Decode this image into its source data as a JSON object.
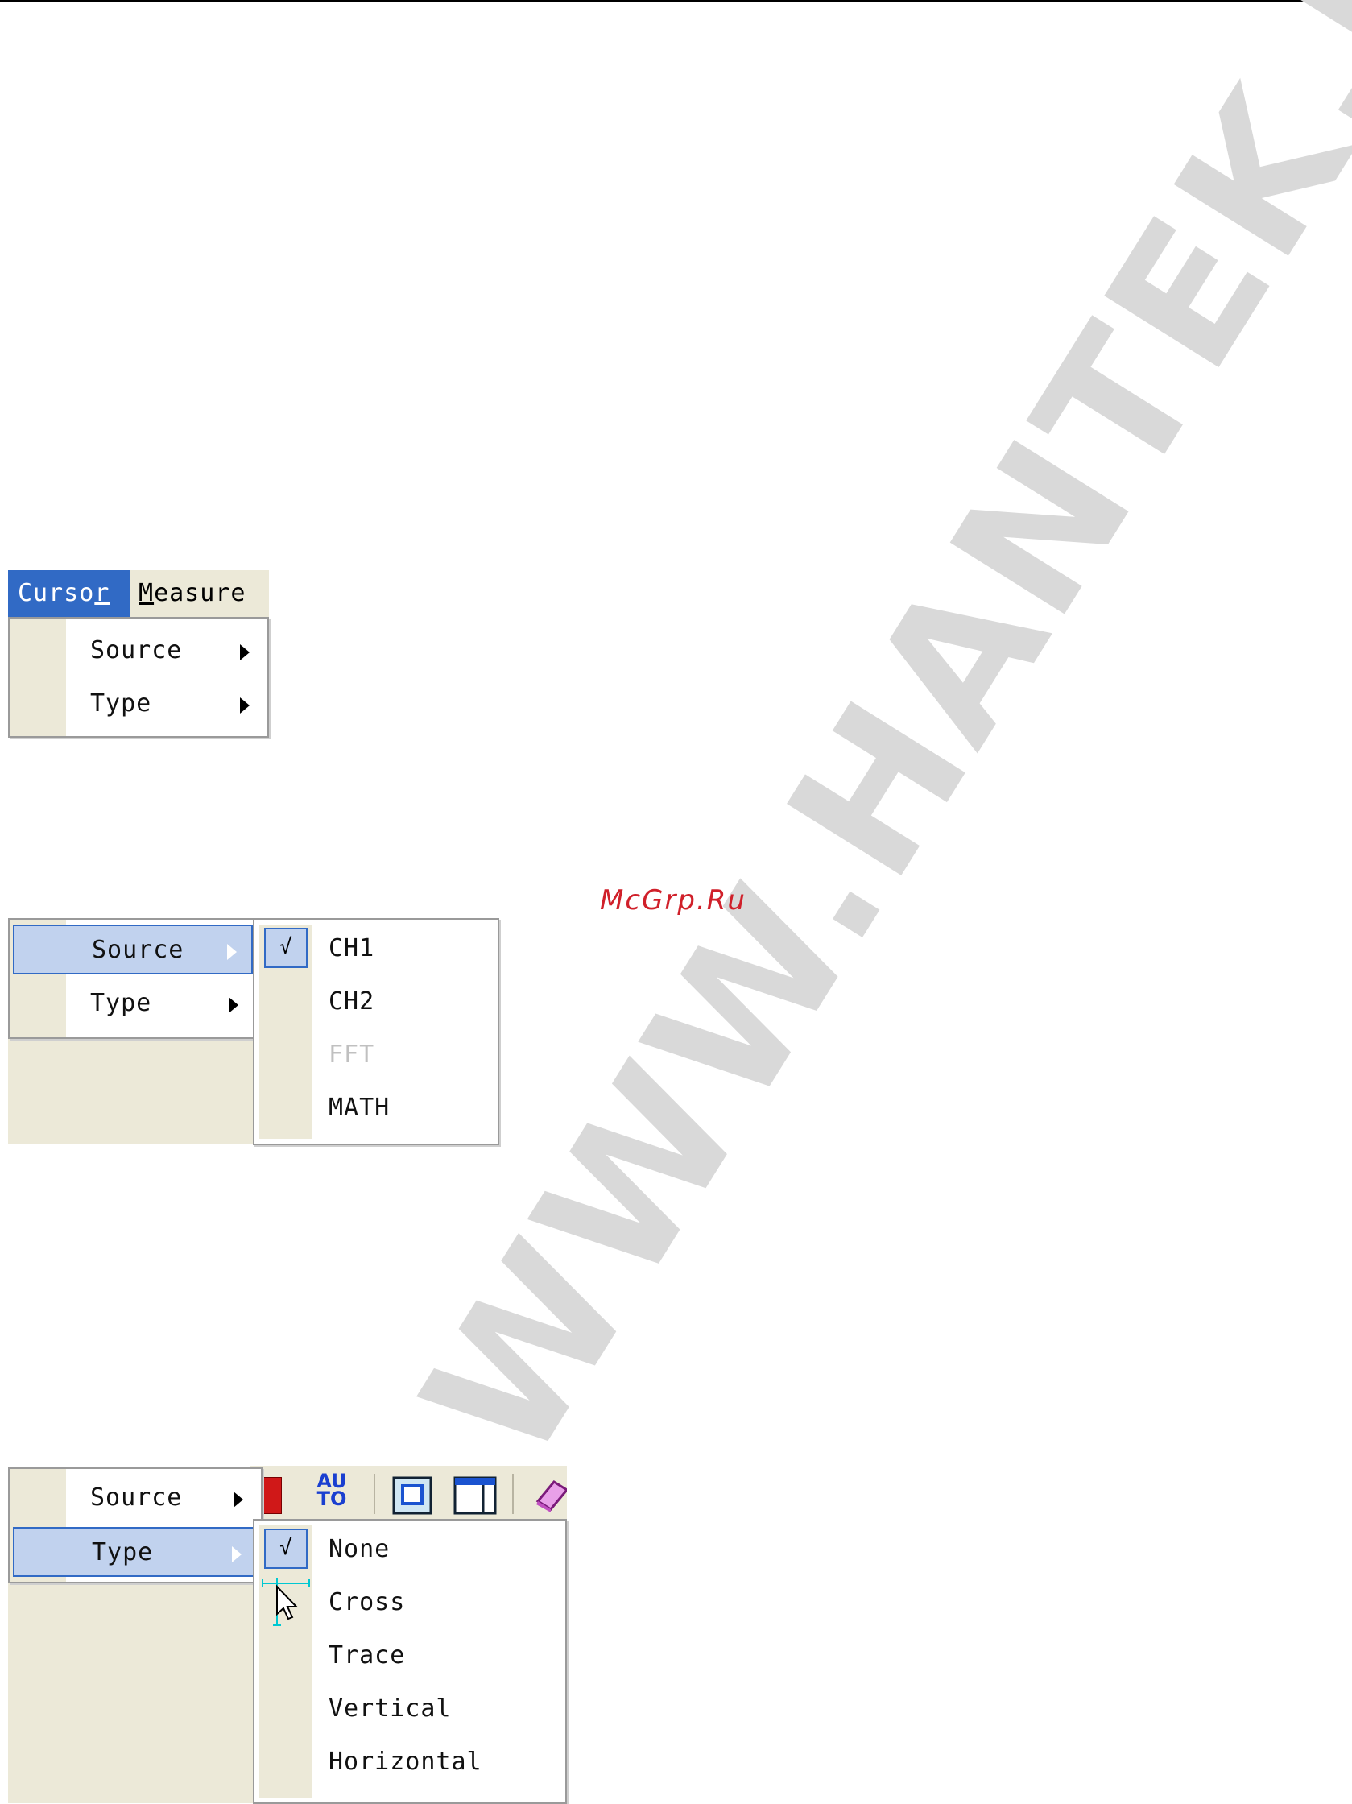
{
  "watermark": {
    "text": "WWW.HANTEK.RU",
    "site_label": "McGrp.Ru"
  },
  "section1": {
    "menubar": [
      {
        "prefix": "Curso",
        "accel": "r",
        "suffix": "",
        "active": true
      },
      {
        "prefix": "",
        "accel": "M",
        "suffix": "easure",
        "active": false
      }
    ],
    "items": [
      {
        "label": "Source",
        "has_submenu": true
      },
      {
        "label": "Type",
        "has_submenu": true
      }
    ]
  },
  "section2": {
    "items": [
      {
        "label": "Source",
        "has_submenu": true,
        "highlighted": true
      },
      {
        "label": "Type",
        "has_submenu": true,
        "highlighted": false
      }
    ],
    "submenu": [
      {
        "label": "CH1",
        "checked": true,
        "check_mark": "√",
        "enabled": true
      },
      {
        "label": "CH2",
        "checked": false,
        "enabled": true
      },
      {
        "label": "FFT",
        "checked": false,
        "enabled": false
      },
      {
        "label": "MATH",
        "checked": false,
        "enabled": true
      }
    ]
  },
  "section3": {
    "items": [
      {
        "label": "Source",
        "has_submenu": true,
        "highlighted": false
      },
      {
        "label": "Type",
        "has_submenu": true,
        "highlighted": true
      }
    ],
    "toolbar": {
      "auto_top": "AU",
      "auto_bottom": "TO"
    },
    "submenu": [
      {
        "label": "None",
        "checked": true,
        "check_mark": "√"
      },
      {
        "label": "Cross",
        "checked": false
      },
      {
        "label": "Trace",
        "checked": false
      },
      {
        "label": "Vertical",
        "checked": false
      },
      {
        "label": "Horizontal",
        "checked": false
      }
    ]
  },
  "colors": {
    "highlight": "#c1d2ee",
    "highlight_border": "#316ac5",
    "menubar_active": "#316ac5",
    "gutter": "#ece9d8",
    "watermark": "#d9d9d9",
    "site_label": "#d0202a"
  }
}
